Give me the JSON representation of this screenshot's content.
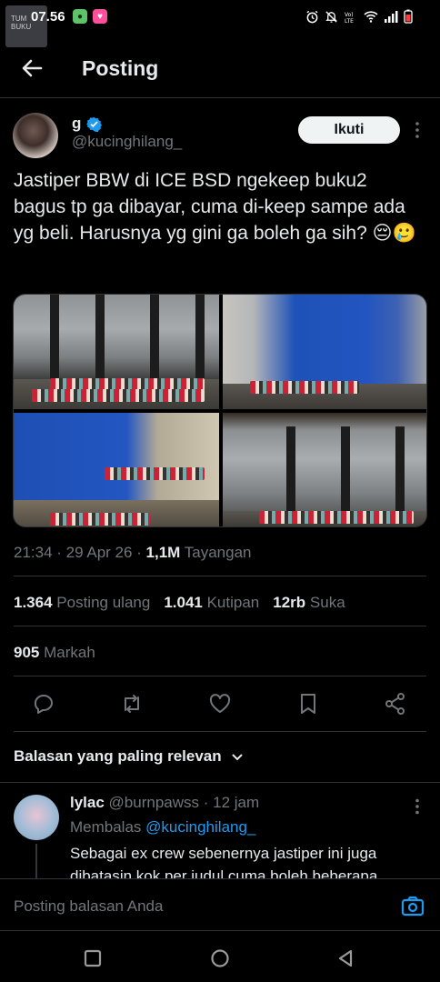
{
  "status_bar": {
    "time": "07.56",
    "watermark": "TUM BUKU"
  },
  "header": {
    "title": "Posting"
  },
  "tweet": {
    "author_name": "g",
    "author_handle": "@kucinghilang_",
    "follow_label": "Ikuti",
    "text": "Jastiper BBW di ICE BSD ngekeep buku2 bagus tp ga dibayar, cuma di-keep sampe ada yg beli. Harusnya yg gini ga boleh ga sih? 😔🥲",
    "time": "21:34",
    "date": "29 Apr 26",
    "views": "1,1M",
    "views_label": "Tayangan",
    "reposts": "1.364",
    "reposts_label": "Posting ulang",
    "quotes": "1.041",
    "quotes_label": "Kutipan",
    "likes": "12rb",
    "likes_label": "Suka",
    "bookmarks": "905",
    "bookmarks_label": "Markah"
  },
  "replies_sort": {
    "label": "Balasan yang paling relevan"
  },
  "reply": {
    "name": "lylac",
    "handle": "@burnpawss",
    "time": "12 jam",
    "replying_label": "Membalas",
    "replying_to": "@kucinghilang_",
    "text": "Sebagai ex crew sebenernya jastiper ini juga dibatasin kok per judul cuma boleh beberapa"
  },
  "compose": {
    "placeholder": "Posting balasan Anda"
  },
  "colors": {
    "background": "#000000",
    "accent": "#1d9bf0",
    "secondary_text": "#71767b",
    "primary_text": "#e7e9ea"
  }
}
